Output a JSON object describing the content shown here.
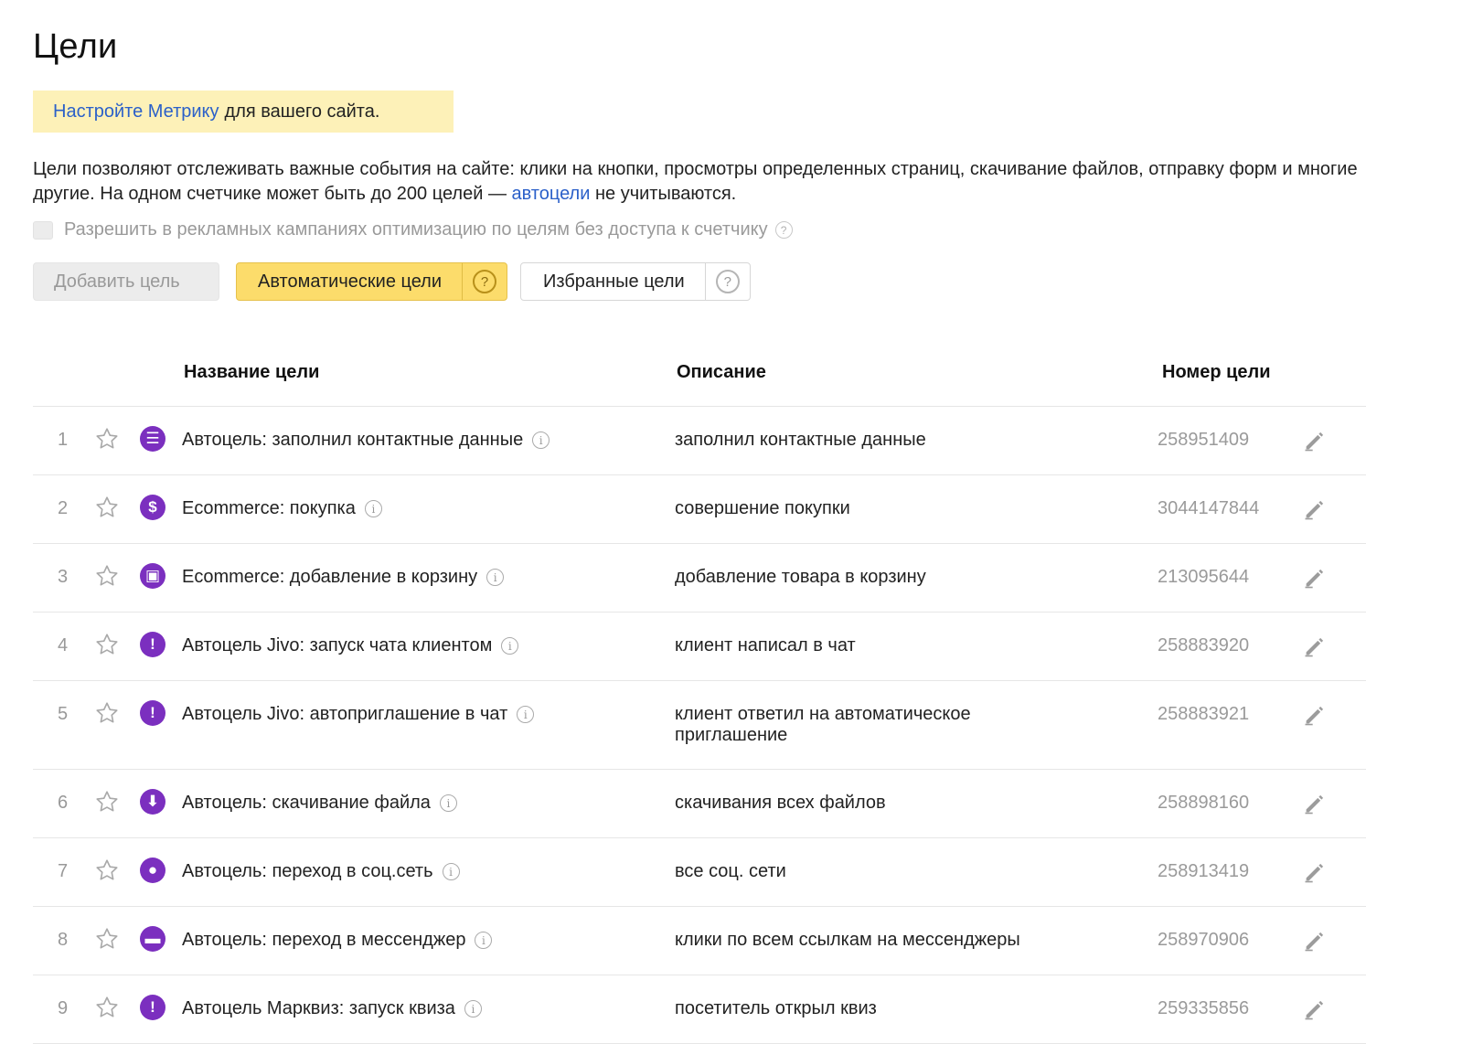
{
  "page": {
    "title": "Цели"
  },
  "notice": {
    "link_text": "Настройте Метрику",
    "text": "для вашего сайта."
  },
  "description": {
    "part1": "Цели позволяют отслеживать важные события на сайте: клики на кнопки, просмотры определенных страниц, скачивание файлов, отправку форм и многие другие. На одном счетчике может быть до 200 целей — ",
    "link_text": "автоцели",
    "part2": " не учитываются."
  },
  "allow_checkbox": {
    "label": "Разрешить в рекламных кампаниях оптимизацию по целям без доступа к счетчику",
    "checked": false
  },
  "toolbar": {
    "add_label": "Добавить цель",
    "auto_label": "Автоматические цели",
    "fav_label": "Избранные цели",
    "help_glyph": "?"
  },
  "table": {
    "headers": {
      "name": "Название цели",
      "desc": "Описание",
      "num": "Номер цели"
    },
    "rows": [
      {
        "idx": "1",
        "icon": "contact-card-icon",
        "glyph": "☰",
        "name": "Автоцель: заполнил контактные данные",
        "desc": "заполнил контактные данные",
        "num": "258951409"
      },
      {
        "idx": "2",
        "icon": "dollar-icon",
        "glyph": "$",
        "name": "Ecommerce: покупка",
        "desc": "совершение покупки",
        "num": "3044147844"
      },
      {
        "idx": "3",
        "icon": "box-icon",
        "glyph": "▣",
        "name": "Ecommerce: добавление в корзину",
        "desc": "добавление товара в корзину",
        "num": "213095644"
      },
      {
        "idx": "4",
        "icon": "exclamation-icon",
        "glyph": "!",
        "name": "Автоцель Jivo: запуск чата клиентом",
        "desc": "клиент написал в чат",
        "num": "258883920"
      },
      {
        "idx": "5",
        "icon": "exclamation-icon",
        "glyph": "!",
        "name": "Автоцель Jivo: автоприглашение в чат",
        "desc": "клиент ответил на автоматическое приглашение",
        "num": "258883921"
      },
      {
        "idx": "6",
        "icon": "download-icon",
        "glyph": "⬇",
        "name": "Автоцель: скачивание файла",
        "desc": "скачивания всех файлов",
        "num": "258898160"
      },
      {
        "idx": "7",
        "icon": "user-icon",
        "glyph": "●",
        "name": "Автоцель: переход в соц.сеть",
        "desc": "все соц. сети",
        "num": "258913419"
      },
      {
        "idx": "8",
        "icon": "chat-bubble-icon",
        "glyph": "▬",
        "name": "Автоцель: переход в мессенджер",
        "desc": "клики по всем ссылкам на мессенджеры",
        "num": "258970906"
      },
      {
        "idx": "9",
        "icon": "exclamation-icon",
        "glyph": "!",
        "name": "Автоцель Марквиз: запуск квиза",
        "desc": "посетитель открыл квиз",
        "num": "259335856"
      }
    ]
  },
  "colors": {
    "link": "#2b60c9",
    "notice_bg": "#fdf1b8",
    "primary_button": "#fcdc6b",
    "goal_icon": "#7b2fbf"
  }
}
